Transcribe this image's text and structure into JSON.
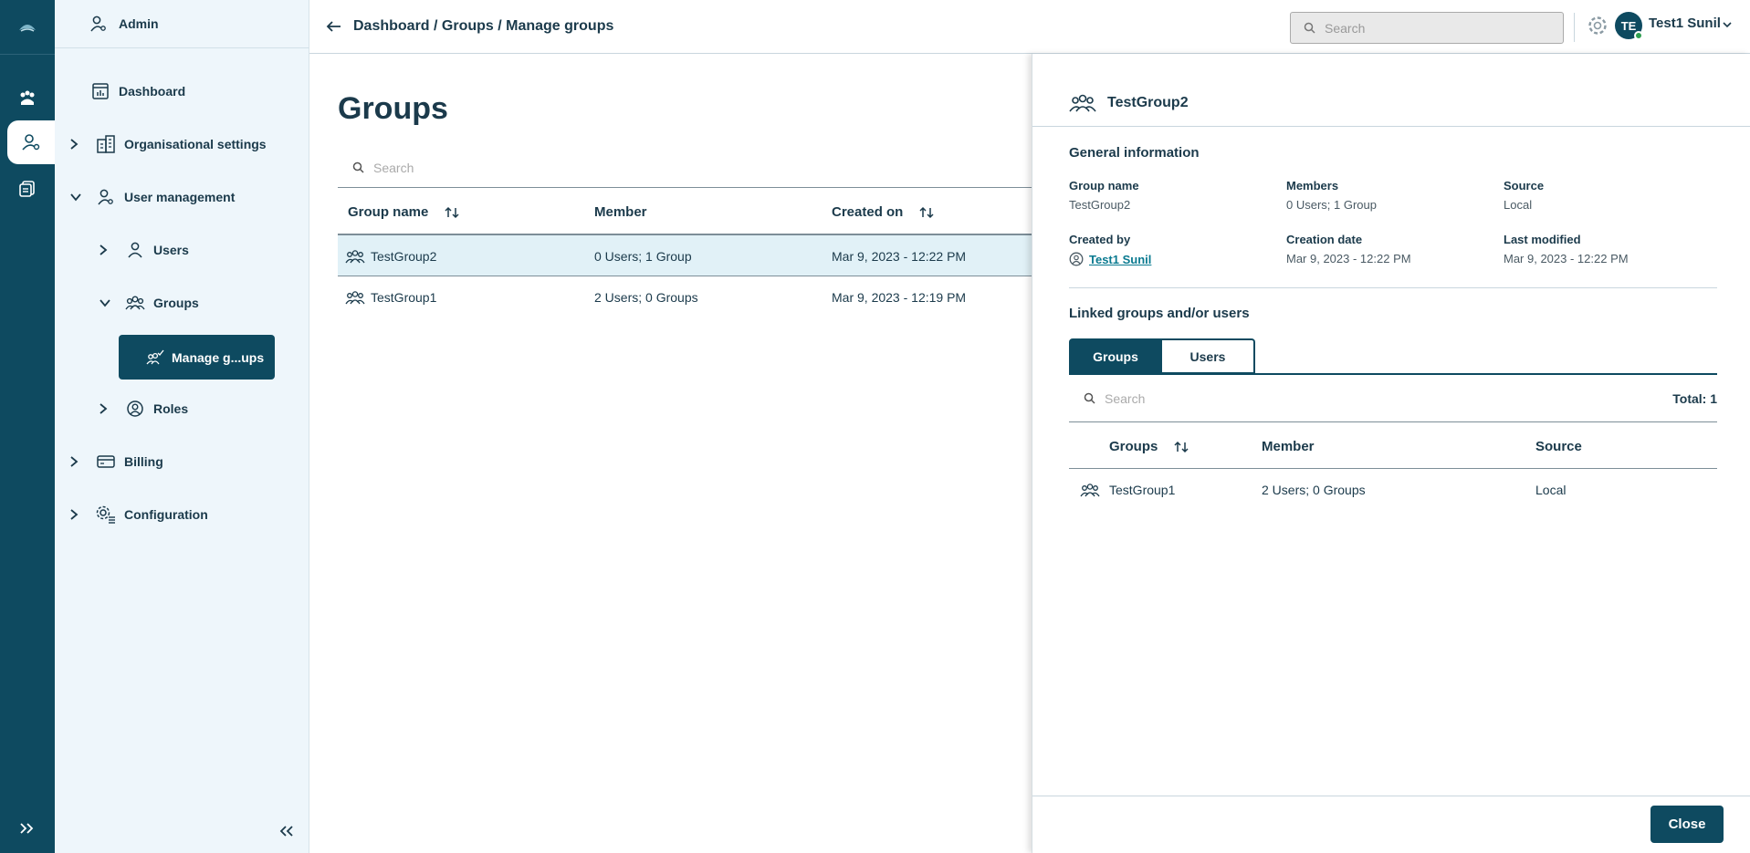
{
  "breadcrumb": {
    "text": "Dashboard / Groups / Manage groups"
  },
  "topbar": {
    "search_placeholder": "Search",
    "user_initials": "TE",
    "user_name": "Test1 Sunil"
  },
  "sidebar": {
    "admin_label": "Admin",
    "items": {
      "dashboard": "Dashboard",
      "organisational": "Organisational settings",
      "user_management": "User management",
      "users": "Users",
      "groups": "Groups",
      "manage_groups": "Manage g...ups",
      "roles": "Roles",
      "billing": "Billing",
      "configuration": "Configuration"
    }
  },
  "main": {
    "title": "Groups",
    "search_placeholder": "Search",
    "columns": {
      "group_name": "Group name",
      "member": "Member",
      "created_on": "Created on"
    },
    "rows": [
      {
        "name": "TestGroup2",
        "member": "0 Users; 1 Group",
        "created": "Mar 9, 2023 - 12:22 PM",
        "selected": true
      },
      {
        "name": "TestGroup1",
        "member": "2 Users; 0 Groups",
        "created": "Mar 9, 2023 - 12:19 PM",
        "selected": false
      }
    ]
  },
  "drawer": {
    "title": "TestGroup2",
    "general_title": "General information",
    "fields": {
      "group_name_label": "Group name",
      "group_name_value": "TestGroup2",
      "members_label": "Members",
      "members_value": "0 Users; 1 Group",
      "source_label": "Source",
      "source_value": "Local",
      "created_by_label": "Created by",
      "created_by_value": "Test1 Sunil",
      "creation_date_label": "Creation date",
      "creation_date_value": "Mar 9, 2023 - 12:22 PM",
      "last_modified_label": "Last modified",
      "last_modified_value": "Mar 9, 2023 - 12:22 PM"
    },
    "linked_title": "Linked groups and/or users",
    "tabs": {
      "groups": "Groups",
      "users": "Users"
    },
    "search_placeholder": "Search",
    "total": "Total: 1",
    "columns": {
      "groups": "Groups",
      "member": "Member",
      "source": "Source"
    },
    "rows": [
      {
        "name": "TestGroup1",
        "member": "2 Users; 0 Groups",
        "source": "Local"
      }
    ],
    "close_label": "Close"
  },
  "colors": {
    "primary": "#0e4a60",
    "selected_row": "#e1f1f7",
    "link": "#0a7a90",
    "status_online": "#2e9e4f"
  }
}
